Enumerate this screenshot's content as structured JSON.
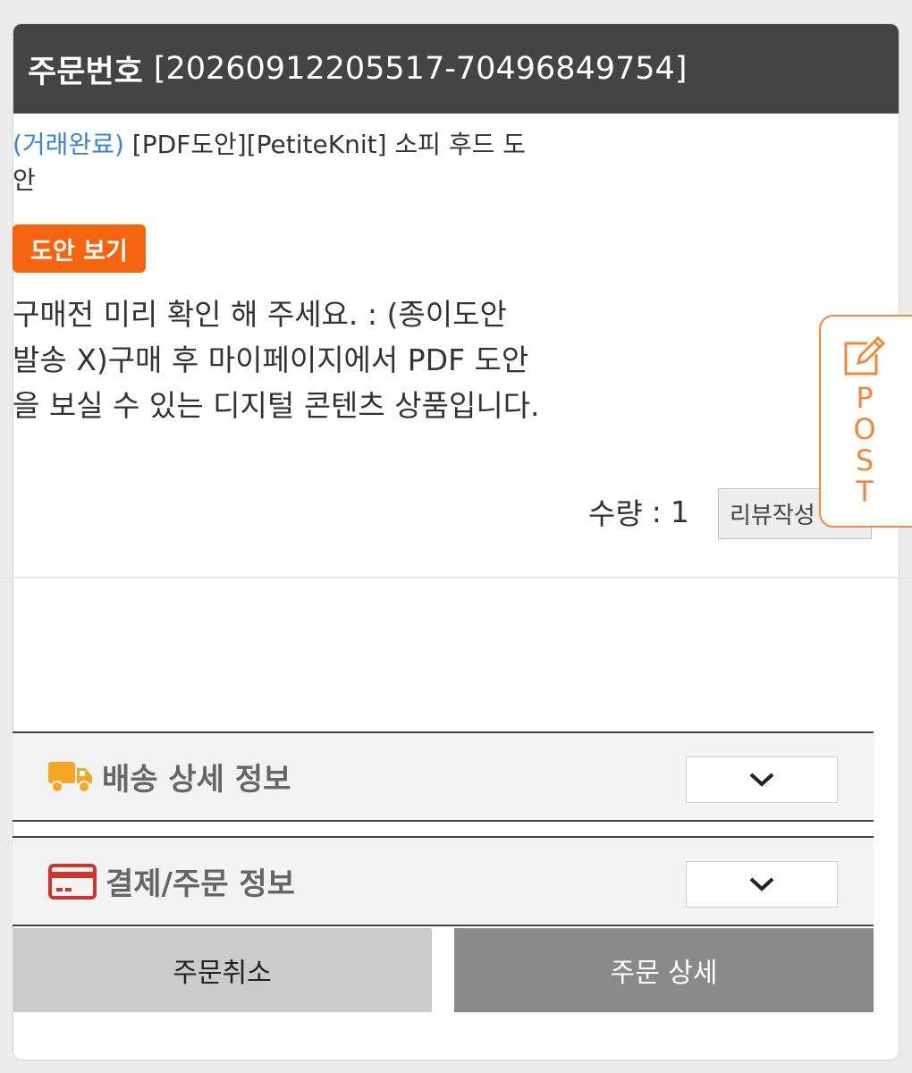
{
  "header": {
    "label": "주문번호",
    "order_number": "[20260912205517-70496849754]"
  },
  "product": {
    "status": "(거래완료)",
    "title": "[PDF도안][PetiteKnit] 소피 후드 도안"
  },
  "pattern_button": "도안 보기",
  "notice": "구매전 미리 확인 해 주세요. : (종이도안 발송 X)구매 후 마이페이지에서 PDF 도안을 보실 수 있는 디지털 콘텐츠 상품입니다.",
  "quantity": {
    "label": "수량",
    "separator": ":",
    "value": "1"
  },
  "review_button": "리뷰작성",
  "accordions": [
    {
      "title": "배송 상세 정보",
      "icon": "truck-icon",
      "color": "#f5a623"
    },
    {
      "title": "결제/주문 정보",
      "icon": "credit-card-icon",
      "color": "#d0342c"
    }
  ],
  "buttons": {
    "cancel": "주문취소",
    "detail": "주문 상세"
  },
  "post_tab": {
    "icon": "edit-icon",
    "letters": [
      "P",
      "O",
      "S",
      "T"
    ],
    "color": "#f08a3a"
  }
}
